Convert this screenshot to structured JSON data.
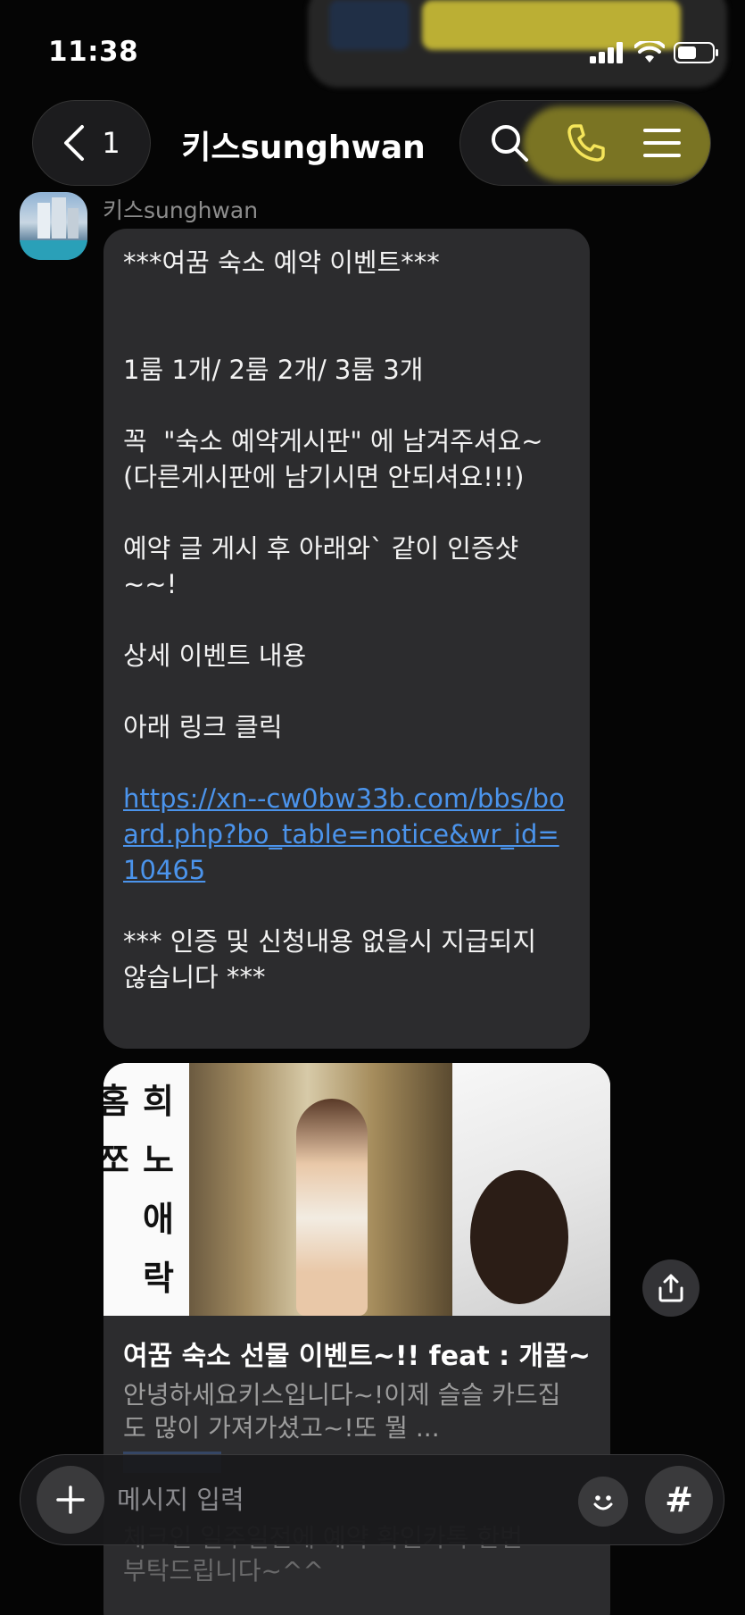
{
  "status_bar": {
    "time": "11:38"
  },
  "header": {
    "back_count": "1",
    "title": "키스sunghwan"
  },
  "message": {
    "sender": "키스sunghwan",
    "lines": {
      "l1": "***여꿈 숙소 예약 이벤트***",
      "l2": "1룸 1개/ 2룸 2개/ 3룸 3개",
      "l3": "꼭  \"숙소 예약게시판\" 에 남겨주셔요~\n(다른게시판에 남기시면 안되셔요!!!)",
      "l4": "예약 글 게시 후 아래와` 같이 인증샷\n~~!",
      "l5": "상세 이벤트 내용",
      "l6": "아래 링크 클릭",
      "link": "https://xn--cw0bw33b.com/bbs/board.php?bo_table=notice&wr_id=10465",
      "l7": "*** 인증 및 신청내용 없을시 지급되지\n않습니다 ***"
    }
  },
  "link_card": {
    "image_text": [
      "홈",
      "희",
      "쪼",
      "노",
      "애",
      "락"
    ],
    "title": "여꿈 숙소 선물 이벤트~!! feat : 개꿀~",
    "description": "안녕하세요키스입니다~!이제 슬슬 카드집\n도 많이 가져가셨고~!또 뭘 ...",
    "description_behind": "체크인 일주일전에 예약 확인카톡 한번\n부탁드립니다~^^"
  },
  "input_bar": {
    "placeholder": "메시지 입력",
    "hash_label": "#"
  }
}
